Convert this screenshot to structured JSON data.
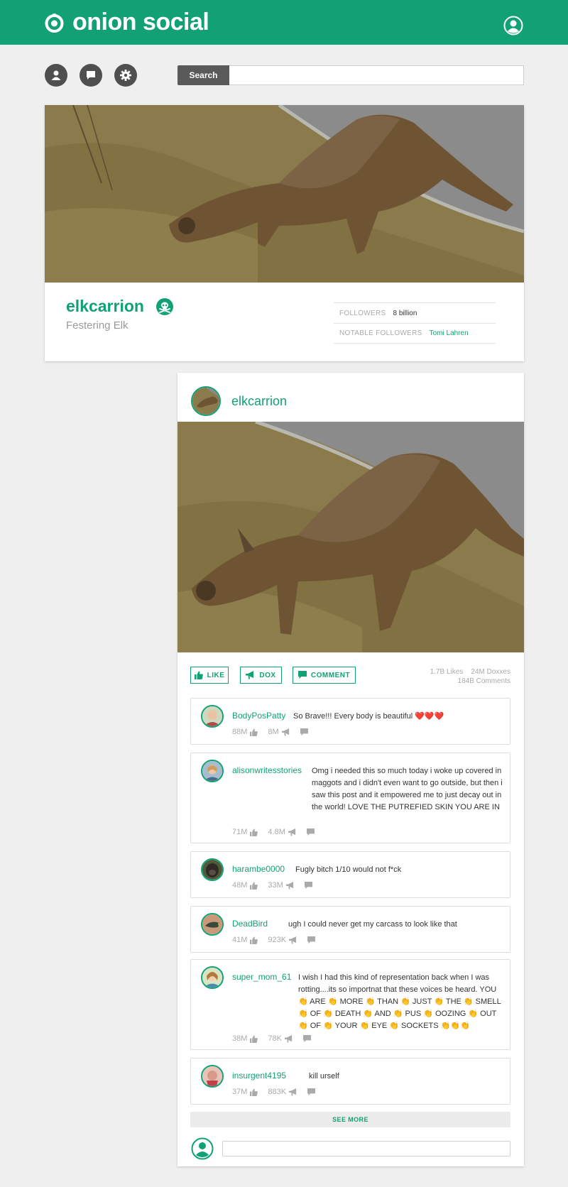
{
  "app": {
    "name": "onion social"
  },
  "colors": {
    "brand": "#12a175",
    "header_bg": "#12a175",
    "page_bg": "#efefef",
    "toolbar_icon": "#4f4f4f"
  },
  "toolbar": {
    "icons": [
      "profile-icon",
      "messages-icon",
      "settings-icon"
    ],
    "search_label": "Search",
    "search_placeholder": ""
  },
  "profile": {
    "username": "elkcarrion",
    "subtitle": "Festering Elk",
    "badge_icon": "skull-crossbones-icon",
    "stats": [
      {
        "label": "FOLLOWERS",
        "value": "8 billion"
      },
      {
        "label": "NOTABLE FOLLOWERS",
        "value": "Tomi Lahren"
      }
    ]
  },
  "post": {
    "author": "elkcarrion",
    "actions": {
      "like": "LIKE",
      "dox": "DOX",
      "comment": "COMMENT"
    },
    "stats": {
      "likes": "1.7B Likes",
      "doxxes": "24M Doxxes",
      "comments": "184B Comments"
    },
    "comments": [
      {
        "user": "BodyPosPatty",
        "text": "So Brave!!! Every body is beautiful ❤️❤️❤️",
        "likes": "88M",
        "doxxes": "8M"
      },
      {
        "user": "alisonwritesstories",
        "text": "Omg i needed this so much today i woke up covered in maggots and i didn't even want to go outside, but then i saw this post and it empowered me to just decay out in the world! LOVE THE PUTREFIED SKIN YOU ARE IN",
        "likes": "71M",
        "doxxes": "4.8M"
      },
      {
        "user": "harambe0000",
        "text": "Fugly bitch 1/10 would not f*ck",
        "likes": "48M",
        "doxxes": "33M"
      },
      {
        "user": "DeadBird",
        "text": "ugh I could never get my carcass to look like that",
        "likes": "41M",
        "doxxes": "923K"
      },
      {
        "user": "super_mom_61",
        "text": "I wish I had this kind of representation back when I was rotting....its so importnat that these voices be heard. YOU 👏 ARE 👏 MORE 👏 THAN 👏 JUST 👏 THE 👏 SMELL 👏 OF 👏 DEATH 👏 AND 👏 PUS 👏 OOZING 👏 OUT 👏 OF 👏 YOUR 👏 EYE 👏 SOCKETS 👏👏👏",
        "likes": "38M",
        "doxxes": "78K"
      },
      {
        "user": "insurgent4195",
        "text": "kill urself",
        "likes": "37M",
        "doxxes": "883K"
      }
    ],
    "see_more": "SEE MORE",
    "comment_placeholder": ""
  }
}
